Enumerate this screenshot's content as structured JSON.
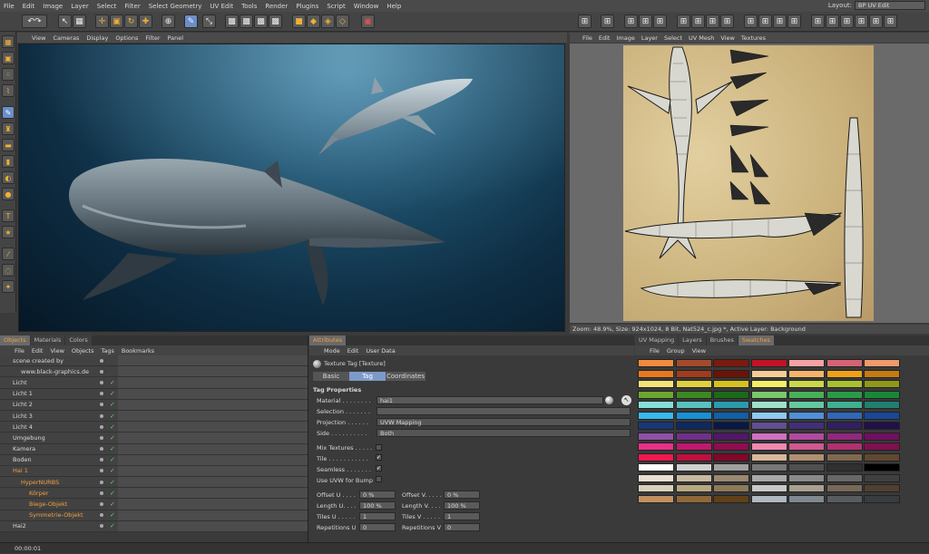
{
  "menubar": {
    "items": [
      "File",
      "Edit",
      "Image",
      "Layer",
      "Select",
      "Filter",
      "Select Geometry",
      "UV Edit",
      "Tools",
      "Render",
      "Plugins",
      "Script",
      "Window",
      "Help"
    ],
    "layout_label": "Layout:",
    "layout_value": "BP UV Edit"
  },
  "viewport": {
    "menu": [
      "View",
      "Cameras",
      "Display",
      "Options",
      "Filter",
      "Panel"
    ]
  },
  "uv": {
    "menu": [
      "File",
      "Edit",
      "Image",
      "Layer",
      "Select",
      "UV Mesh",
      "View",
      "Textures"
    ],
    "status": "Zoom: 48.9%, Size: 924x1024, 8 Bit, Nat524_c.jpg *, Active Layer: Background"
  },
  "objects": {
    "tabs": [
      "Objects",
      "Materials",
      "Colors"
    ],
    "menu": [
      "File",
      "Edit",
      "View",
      "Objects",
      "Tags",
      "Bookmarks"
    ],
    "rows": [
      {
        "name": "scene created by",
        "indent": 0
      },
      {
        "name": "www.black-graphics.de",
        "indent": 1
      },
      {
        "name": "Licht",
        "indent": 0
      },
      {
        "name": "Licht 1",
        "indent": 0
      },
      {
        "name": "Licht 2",
        "indent": 0
      },
      {
        "name": "Licht 3",
        "indent": 0
      },
      {
        "name": "Licht 4",
        "indent": 0
      },
      {
        "name": "Umgebung",
        "indent": 0
      },
      {
        "name": "Kamera",
        "indent": 0
      },
      {
        "name": "Boden",
        "indent": 0
      },
      {
        "name": "Hai 1",
        "indent": 0
      },
      {
        "name": "HyperNURBS",
        "indent": 1
      },
      {
        "name": "Körper",
        "indent": 2
      },
      {
        "name": "Biege-Objekt",
        "indent": 2
      },
      {
        "name": "Symmetrie-Objekt",
        "indent": 2
      },
      {
        "name": "Hai2",
        "indent": 0
      }
    ]
  },
  "attributes": {
    "tab": "Attributes",
    "menu": [
      "Mode",
      "Edit",
      "User Data"
    ],
    "header": "Texture Tag [Texture]",
    "subtabs": [
      "Basic",
      "Tag",
      "Coordinates"
    ],
    "section": "Tag Properties",
    "material_label": "Material . . . . . . . .",
    "material_value": "hai1",
    "selection_label": "Selection . . . . . . .",
    "projection_label": "Projection . . . . . .",
    "projection_value": "UVW Mapping",
    "side_label": "Side . . . . . . . . . .",
    "side_value": "Both",
    "mix_label": "Mix Textures . . . . .",
    "tile_label": "Tile . . . . . . . . . . .",
    "seamless_label": "Seamless . . . . . . .",
    "uvwbump_label": "Use UVW for Bump",
    "offset_u_label": "Offset U . . . .",
    "offset_u": "0 %",
    "offset_v_label": "Offset V. . . . .",
    "offset_v": "0 %",
    "length_u_label": "Length U. . . .",
    "length_u": "100 %",
    "length_v_label": "Length V. . . .",
    "length_v": "100 %",
    "tiles_u_label": "Tiles U . . . . .",
    "tiles_u": "1",
    "tiles_v_label": "Tiles V . . . . .",
    "tiles_v": "1",
    "rep_u_label": "Repetitions U",
    "rep_u": "0",
    "rep_v_label": "Repetitions V",
    "rep_v": "0"
  },
  "swatches": {
    "tabs": [
      "UV Mapping",
      "Layers",
      "Brushes",
      "Swatches"
    ],
    "menu": [
      "File",
      "Group",
      "View"
    ],
    "colors": [
      "#f58a3c",
      "#a44a2a",
      "#7c1a10",
      "#c41225",
      "#f6a2a2",
      "#d46474",
      "#ee9a6a",
      "#e87820",
      "#a03c1c",
      "#6a1408",
      "#f4cc98",
      "#f6b46a",
      "#f0a018",
      "#c47a10",
      "#f6e27a",
      "#e0d040",
      "#d6c020",
      "#f0f068",
      "#c8d84a",
      "#a8c030",
      "#909818",
      "#6aa830",
      "#3a8a20",
      "#1a6a18",
      "#7ac86a",
      "#48b058",
      "#2a9a48",
      "#188838",
      "#88ddd8",
      "#58c0c0",
      "#2a9ab0",
      "#a0e0c8",
      "#64c8a0",
      "#40b090",
      "#208070",
      "#38b8f0",
      "#1890d8",
      "#1060a8",
      "#90c8f0",
      "#5090d8",
      "#3068b8",
      "#184898",
      "#183878",
      "#102860",
      "#0a1848",
      "#605090",
      "#403078",
      "#302060",
      "#201048",
      "#9050a8",
      "#703088",
      "#501868",
      "#d070c0",
      "#b04aa0",
      "#902880",
      "#701060",
      "#e8308a",
      "#c01870",
      "#900c50",
      "#f088b0",
      "#d05890",
      "#b03070",
      "#801050",
      "#f01850",
      "#c01040",
      "#800828",
      "#d8b898",
      "#b09070",
      "#806850",
      "#604830",
      "#ffffff",
      "#d0d0d0",
      "#a0a0a0",
      "#787878",
      "#505050",
      "#303030",
      "#000000",
      "#e8e0d0",
      "#c8b8a0",
      "#9a8870",
      "#a8a8a8",
      "#8a8a8a",
      "#686868",
      "#404040",
      "#d8d0b8",
      "#b8a880",
      "#8c7a58",
      "#c8c8c8",
      "#a8a090",
      "#786858",
      "#504030",
      "#c09060",
      "#906838",
      "#604018",
      "#b0b8c0",
      "#808890",
      "#585c60",
      "#383c40"
    ]
  },
  "timeline": {
    "label": "00:00:01"
  }
}
